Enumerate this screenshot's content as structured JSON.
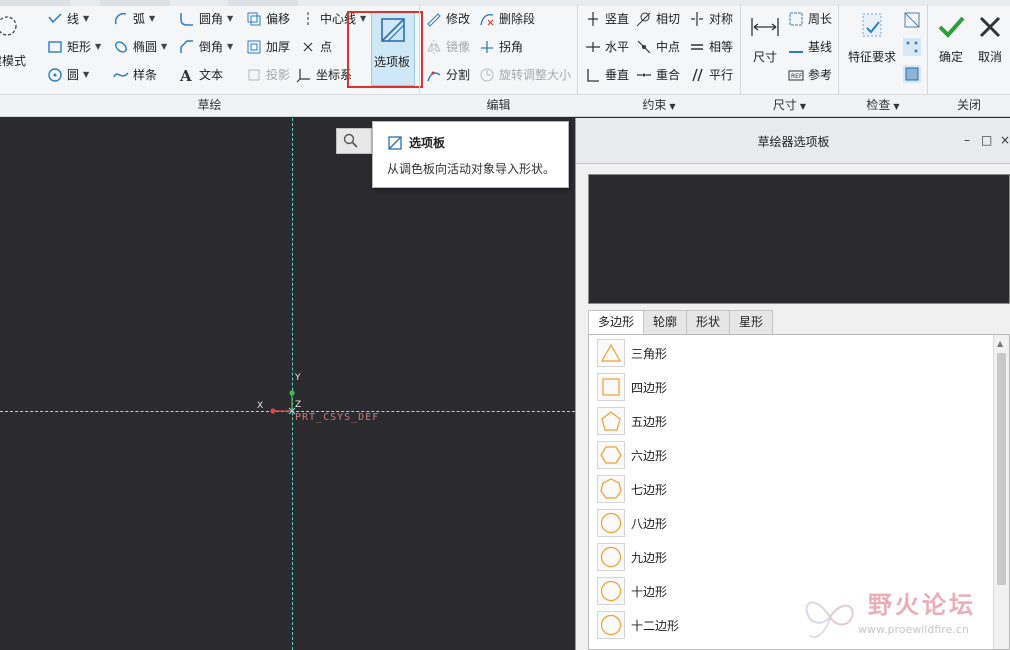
{
  "ribbon": {
    "left_cut": "建模式",
    "sketch": {
      "line": "线",
      "arc": "弧",
      "fillet": "圆角",
      "offset": "偏移",
      "centerline": "中心线",
      "rectangle": "矩形",
      "ellipse": "椭圆",
      "chamfer": "倒角",
      "thicken": "加厚",
      "point": "点",
      "circle": "圆",
      "spline": "样条",
      "text": "文本",
      "project": "投影",
      "csys": "坐标系",
      "palette": "选项板",
      "group_label": "草绘"
    },
    "edit": {
      "modify": "修改",
      "delete_segment": "删除段",
      "mirror": "镜像",
      "corner": "拐角",
      "divide": "分割",
      "rotate_resize": "旋转调整大小",
      "group_label": "编辑"
    },
    "constrain": {
      "vertical": "竖直",
      "tangent": "相切",
      "symmetric": "对称",
      "horizontal": "水平",
      "midpoint": "中点",
      "equal": "相等",
      "perpendicular": "垂直",
      "coincident": "重合",
      "parallel": "平行",
      "group_label": "约束"
    },
    "dimension": {
      "normal": "尺寸",
      "perimeter": "周长",
      "baseline": "基线",
      "reference": "参考",
      "group_label": "尺寸"
    },
    "inspect": {
      "feature_requirements": "特征要求",
      "group_label": "检查"
    },
    "close": {
      "ok": "确定",
      "cancel": "取消",
      "group_label": "关闭"
    }
  },
  "tooltip": {
    "title": "选项板",
    "description": "从调色板向活动对象导入形状。"
  },
  "canvas": {
    "csys_name": "PRT_CSYS_DEF",
    "axis_x": "X",
    "axis_y": "Y",
    "axis_z": "Z"
  },
  "panel": {
    "title": "草绘器选项板",
    "minimize": "–",
    "maximize": "□",
    "close": "×",
    "tabs": [
      "多边形",
      "轮廓",
      "形状",
      "星形"
    ],
    "active_tab": 0,
    "items": [
      {
        "label": "三角形",
        "icon": "triangle-icon"
      },
      {
        "label": "四边形",
        "icon": "square-icon"
      },
      {
        "label": "五边形",
        "icon": "pentagon-icon"
      },
      {
        "label": "六边形",
        "icon": "hexagon-icon"
      },
      {
        "label": "七边形",
        "icon": "heptagon-icon"
      },
      {
        "label": "八边形",
        "icon": "octagon-icon"
      },
      {
        "label": "九边形",
        "icon": "nonagon-icon"
      },
      {
        "label": "十边形",
        "icon": "decagon-icon"
      },
      {
        "label": "十二边形",
        "icon": "dodecagon-icon"
      }
    ]
  },
  "watermark": {
    "title": "野火论坛",
    "url": "www.proewildfire.cn"
  },
  "colors": {
    "canvas_bg": "#2b2b2f",
    "highlight_red": "#d9352c",
    "shape_orange": "#f0a030",
    "axis_cyan": "#5fd0c8",
    "check_green": "#2e9e3c"
  }
}
